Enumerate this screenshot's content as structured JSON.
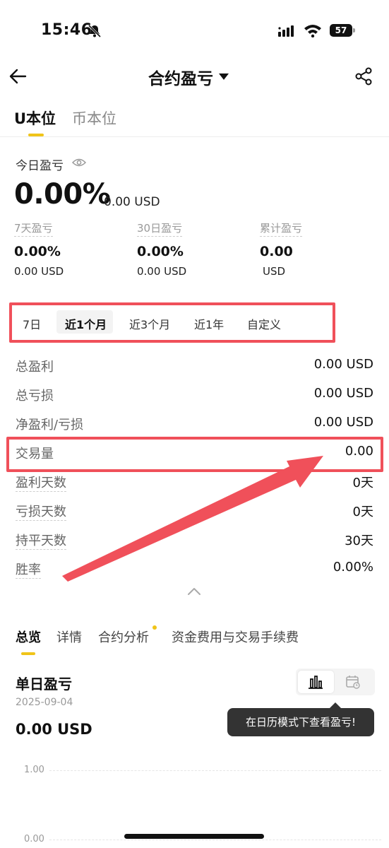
{
  "status_bar": {
    "time": "15:46",
    "battery": "57"
  },
  "header": {
    "title": "合约盈亏"
  },
  "top_tabs": [
    {
      "label": "U本位",
      "active": true
    },
    {
      "label": "币本位",
      "active": false
    }
  ],
  "today": {
    "label": "今日盈亏",
    "pct": "0.00%",
    "usd": "0.00 USD"
  },
  "stats": [
    {
      "label": "7天盈亏",
      "pct": "0.00%",
      "usd": "0.00 USD"
    },
    {
      "label": "30日盈亏",
      "pct": "0.00%",
      "usd": "0.00 USD"
    },
    {
      "label": "累计盈亏",
      "pct": "0.00",
      "usd": "USD"
    }
  ],
  "periods": [
    {
      "label": "7日"
    },
    {
      "label": "近1个月",
      "active": true
    },
    {
      "label": "近3个月"
    },
    {
      "label": "近1年"
    },
    {
      "label": "自定义"
    }
  ],
  "rows": [
    {
      "label": "总盈利",
      "value": "0.00 USD"
    },
    {
      "label": "总亏损",
      "value": "0.00 USD"
    },
    {
      "label": "净盈利/亏损",
      "value": "0.00 USD"
    },
    {
      "label": "交易量",
      "value": "0.00"
    },
    {
      "label": "盈利天数",
      "value": "0天"
    },
    {
      "label": "亏损天数",
      "value": "0天"
    },
    {
      "label": "持平天数",
      "value": "30天"
    },
    {
      "label": "胜率",
      "value": "0.00%"
    }
  ],
  "bottom_tabs": [
    {
      "label": "总览",
      "active": true
    },
    {
      "label": "详情"
    },
    {
      "label": "合约分析"
    },
    {
      "label": "资金费用与交易手续费"
    }
  ],
  "daily": {
    "title": "单日盈亏",
    "date": "2025-09-04",
    "value": "0.00 USD",
    "tooltip": "在日历模式下查看盈亏!",
    "axis": [
      "1.00",
      "0.00"
    ]
  },
  "colors": {
    "accent": "#f0c419",
    "highlight": "#f0505a"
  }
}
